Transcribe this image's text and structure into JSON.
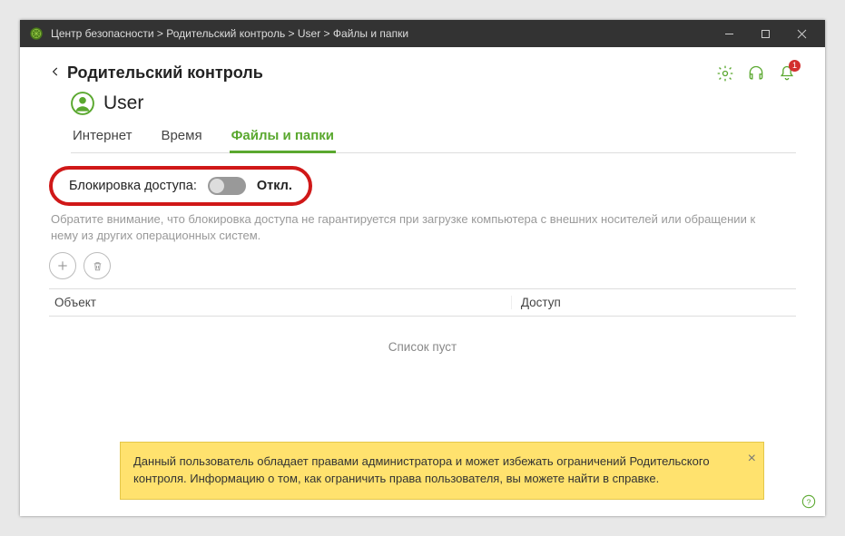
{
  "titlebar": {
    "breadcrumb": "Центр безопасности > Родительский контроль > User > Файлы и папки"
  },
  "header": {
    "back_title": "Родительский контроль",
    "notification_count": "1"
  },
  "user": {
    "name": "User"
  },
  "tabs": {
    "internet": "Интернет",
    "time": "Время",
    "files": "Файлы и папки"
  },
  "block": {
    "label": "Блокировка доступа:",
    "state": "Откл."
  },
  "note": "Обратите внимание, что блокировка доступа не гарантируется при загрузке компьютера с внешних носителей или обращении к нему из других операционных систем.",
  "table": {
    "col_object": "Объект",
    "col_access": "Доступ",
    "empty": "Список пуст"
  },
  "warning": {
    "text": "Данный пользователь обладает правами администратора и может избежать ограничений Родительского контроля. Информацию о том, как ограничить права пользователя, вы можете найти в справке."
  }
}
